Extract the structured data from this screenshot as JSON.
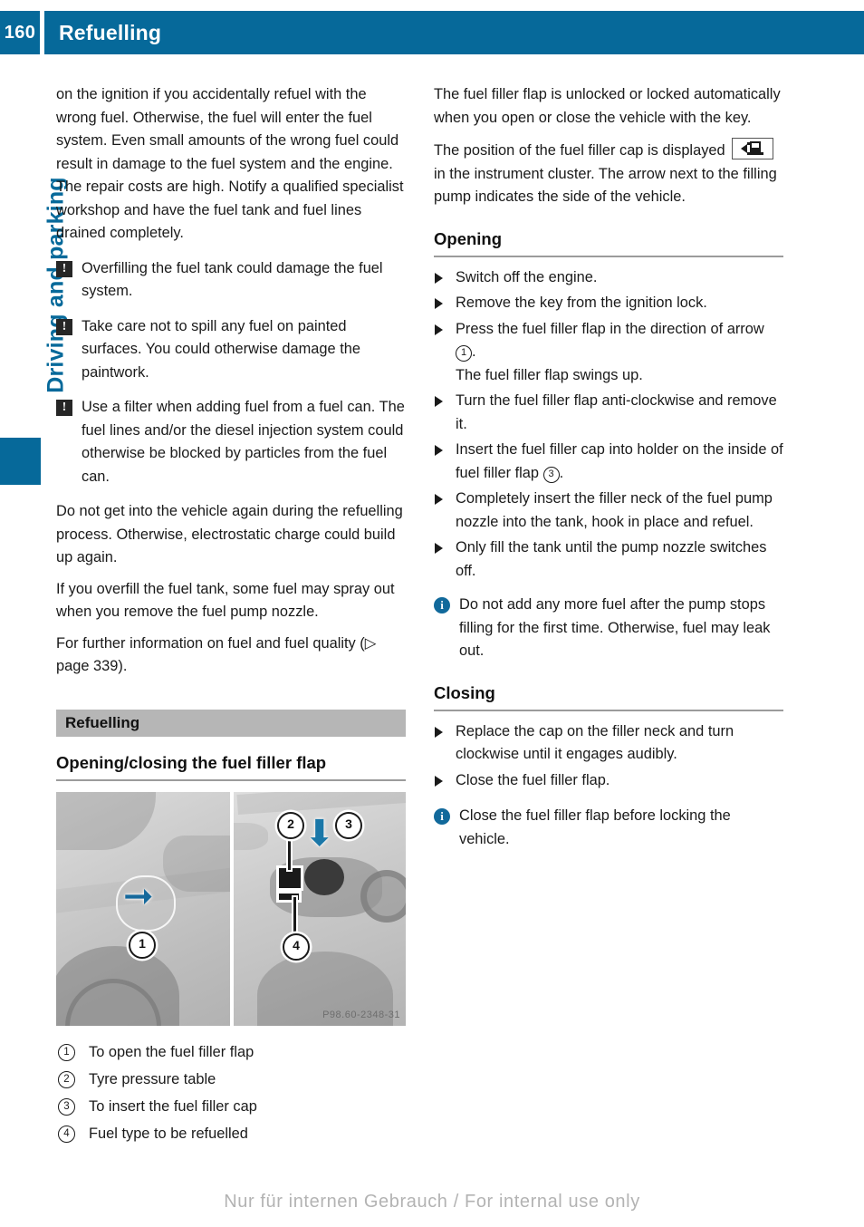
{
  "header": {
    "page_number": "160",
    "title": "Refuelling",
    "bg_color": "#06699a"
  },
  "chapter_tab": {
    "label": "Driving and parking",
    "color": "#06699a"
  },
  "left_column": {
    "continued_paragraph": "on the ignition if you accidentally refuel with the wrong fuel. Otherwise, the fuel will enter the fuel system. Even small amounts of the wrong fuel could result in damage to the fuel system and the engine. The repair costs are high. Notify a qualified specialist workshop and have the fuel tank and fuel lines drained completely.",
    "notices": [
      {
        "icon": "warning-icon",
        "glyph": "!",
        "text": "Overfilling the fuel tank could damage the fuel system."
      },
      {
        "icon": "warning-icon",
        "glyph": "!",
        "text": "Take care not to spill any fuel on painted surfaces. You could otherwise damage the paintwork."
      },
      {
        "icon": "warning-icon",
        "glyph": "!",
        "text": "Use a filter when adding fuel from a fuel can. The fuel lines and/or the diesel injection system could otherwise be blocked by particles from the fuel can."
      }
    ],
    "paragraphs": [
      "Do not get into the vehicle again during the refuelling process. Otherwise, electrostatic charge could build up again.",
      "If you overfill the fuel tank, some fuel may spray out when you remove the fuel pump nozzle."
    ],
    "cross_reference": {
      "prefix": "For further information on fuel and fuel quality",
      "reference": "(▷ page 339)."
    },
    "section_bar_title": "Refuelling",
    "subsection_title": "Opening/closing the fuel filler flap",
    "figure": {
      "watermark": "P98.60-2348-31",
      "callouts": [
        "1",
        "2",
        "3",
        "4"
      ]
    },
    "legend": [
      {
        "num": "1",
        "text": "To open the fuel filler flap"
      },
      {
        "num": "2",
        "text": "Tyre pressure table"
      },
      {
        "num": "3",
        "text": "To insert the fuel filler cap"
      },
      {
        "num": "4",
        "text": "Fuel type to be refuelled"
      }
    ]
  },
  "right_column": {
    "intro_paragraph": "The fuel filler flap is unlocked or locked automatically when you open or close the vehicle with the key.",
    "cluster_paragraph": {
      "before_symbol": "The position of the fuel filler cap is displayed",
      "symbol_name": "fuel-pump-cluster-icon",
      "after_symbol": "in the instrument cluster. The arrow next to the filling pump indicates the side of the vehicle."
    },
    "opening": {
      "heading": "Opening",
      "steps": [
        {
          "text": "Switch off the engine."
        },
        {
          "text": "Remove the key from the ignition lock."
        },
        {
          "text_before": "Press the fuel filler flap in the direction of arrow",
          "circled": "1",
          "text_after": ".",
          "sub": "The fuel filler flap swings up."
        },
        {
          "text": "Turn the fuel filler flap anti-clockwise and remove it."
        },
        {
          "text_before": "Insert the fuel filler cap into holder on the inside of fuel filler flap",
          "circled": "3",
          "text_after": "."
        },
        {
          "text": "Completely insert the filler neck of the fuel pump nozzle into the tank, hook in place and refuel."
        },
        {
          "text": "Only fill the tank until the pump nozzle switches off."
        }
      ],
      "note": {
        "icon": "info-icon",
        "glyph": "i",
        "text": "Do not add any more fuel after the pump stops filling for the first time. Otherwise, fuel may leak out."
      }
    },
    "closing": {
      "heading": "Closing",
      "steps": [
        {
          "text": "Replace the cap on the filler neck and turn clockwise until it engages audibly."
        },
        {
          "text": "Close the fuel filler flap."
        }
      ],
      "note": {
        "icon": "info-icon",
        "glyph": "i",
        "text": "Close the fuel filler flap before locking the vehicle."
      }
    }
  },
  "footer": {
    "text": "Nur für internen Gebrauch / For internal use only"
  }
}
